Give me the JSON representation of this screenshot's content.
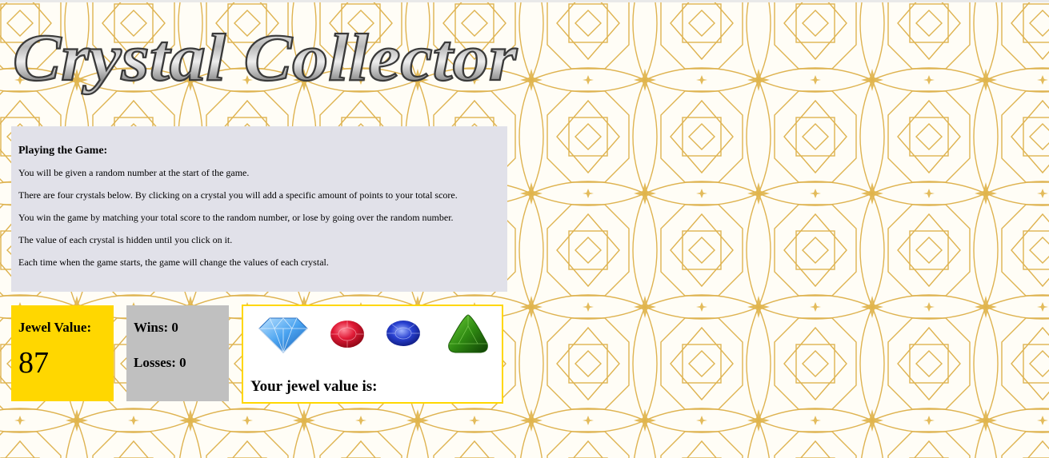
{
  "app": {
    "title": "Crystal Collector"
  },
  "instructions": {
    "heading": "Playing the Game:",
    "lines": [
      "You will be given a random number at the start of the game.",
      "There are four crystals below. By clicking on a crystal you will add a specific amount of points to your total score.",
      "You win the game by matching your total score to the random number, or lose by going over the random number.",
      "The value of each crystal is hidden until you click on it.",
      "Each time when the game starts, the game will change the values of each crystal."
    ]
  },
  "jewel": {
    "label": "Jewel Value:",
    "value": "87"
  },
  "score": {
    "wins_label": "Wins: 0",
    "losses_label": "Losses: 0"
  },
  "crystals": [
    {
      "name": "blue-diamond",
      "color": "#4aa3f0"
    },
    {
      "name": "red-ruby",
      "color": "#d0102a"
    },
    {
      "name": "blue-sapphire",
      "color": "#1e2fb8"
    },
    {
      "name": "green-emerald",
      "color": "#2f8a12"
    }
  ],
  "total": {
    "label": "Your jewel value is:",
    "value": ""
  },
  "colors": {
    "pattern_gold": "#d9a633",
    "instructions_bg": "#e1e1e9",
    "jewel_bg": "#ffd700",
    "score_bg": "#c0c0c0",
    "crystal_border": "#ffd700"
  }
}
